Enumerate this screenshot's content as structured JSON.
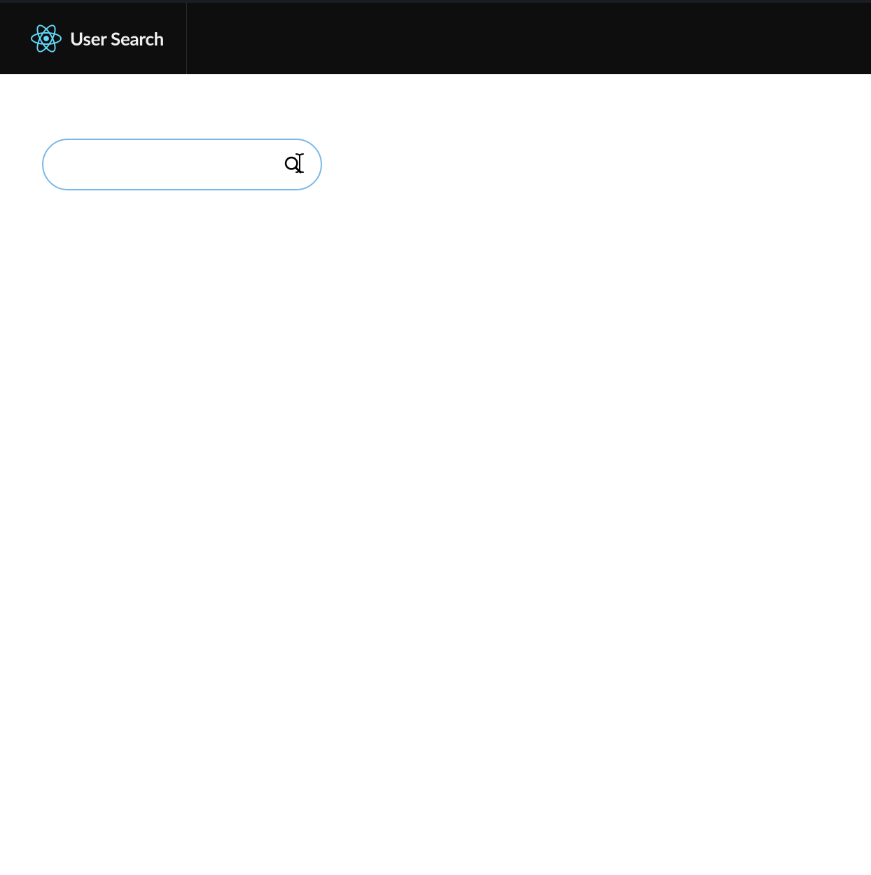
{
  "header": {
    "title": "User Search"
  },
  "search": {
    "value": "",
    "placeholder": ""
  },
  "colors": {
    "accent": "#61dafb",
    "searchBorder": "#7bb8e8",
    "headerBg": "#0e0e0e",
    "bodyBg": "#15171c"
  }
}
